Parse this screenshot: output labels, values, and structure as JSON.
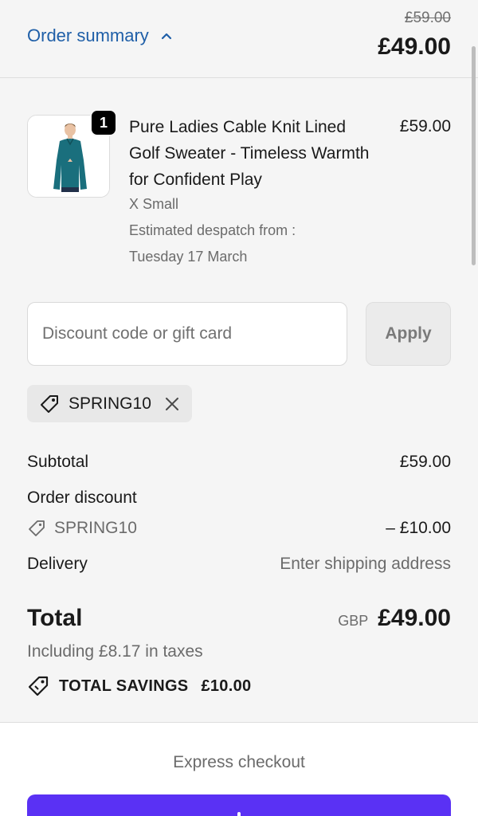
{
  "header": {
    "toggle_label": "Order summary",
    "compare_at_total": "£59.00",
    "total": "£49.00"
  },
  "product": {
    "quantity": "1",
    "title": "Pure Ladies Cable Knit Lined Golf Sweater - Timeless Warmth for Confident Play",
    "price": "£59.00",
    "variant": "X Small",
    "despatch_label": "Estimated despatch from :",
    "despatch_date": "Tuesday 17 March"
  },
  "discount": {
    "placeholder": "Discount code or gift card",
    "apply_label": "Apply",
    "applied_code": "SPRING10"
  },
  "summary": {
    "subtotal_label": "Subtotal",
    "subtotal_value": "£59.00",
    "discount_label": "Order discount",
    "discount_code": "SPRING10",
    "discount_value": "– £10.00",
    "delivery_label": "Delivery",
    "delivery_value": "Enter shipping address"
  },
  "total": {
    "label": "Total",
    "currency": "GBP",
    "amount": "£49.00",
    "tax_note": "Including £8.17 in taxes",
    "savings_label": "TOTAL SAVINGS",
    "savings_amount": "£10.00"
  },
  "checkout": {
    "express_label": "Express checkout",
    "express_button_color": "#5a31f4"
  },
  "colors": {
    "link": "#1f5fa8",
    "muted_text": "#6b6b6b",
    "background": "#f5f5f5",
    "badge": "#000000"
  },
  "icons": {
    "toggle": "chevron-up-icon",
    "chip_tag": "tag-icon",
    "chip_remove": "close-icon",
    "discount_tag": "tag-icon",
    "savings": "tag-icon"
  }
}
